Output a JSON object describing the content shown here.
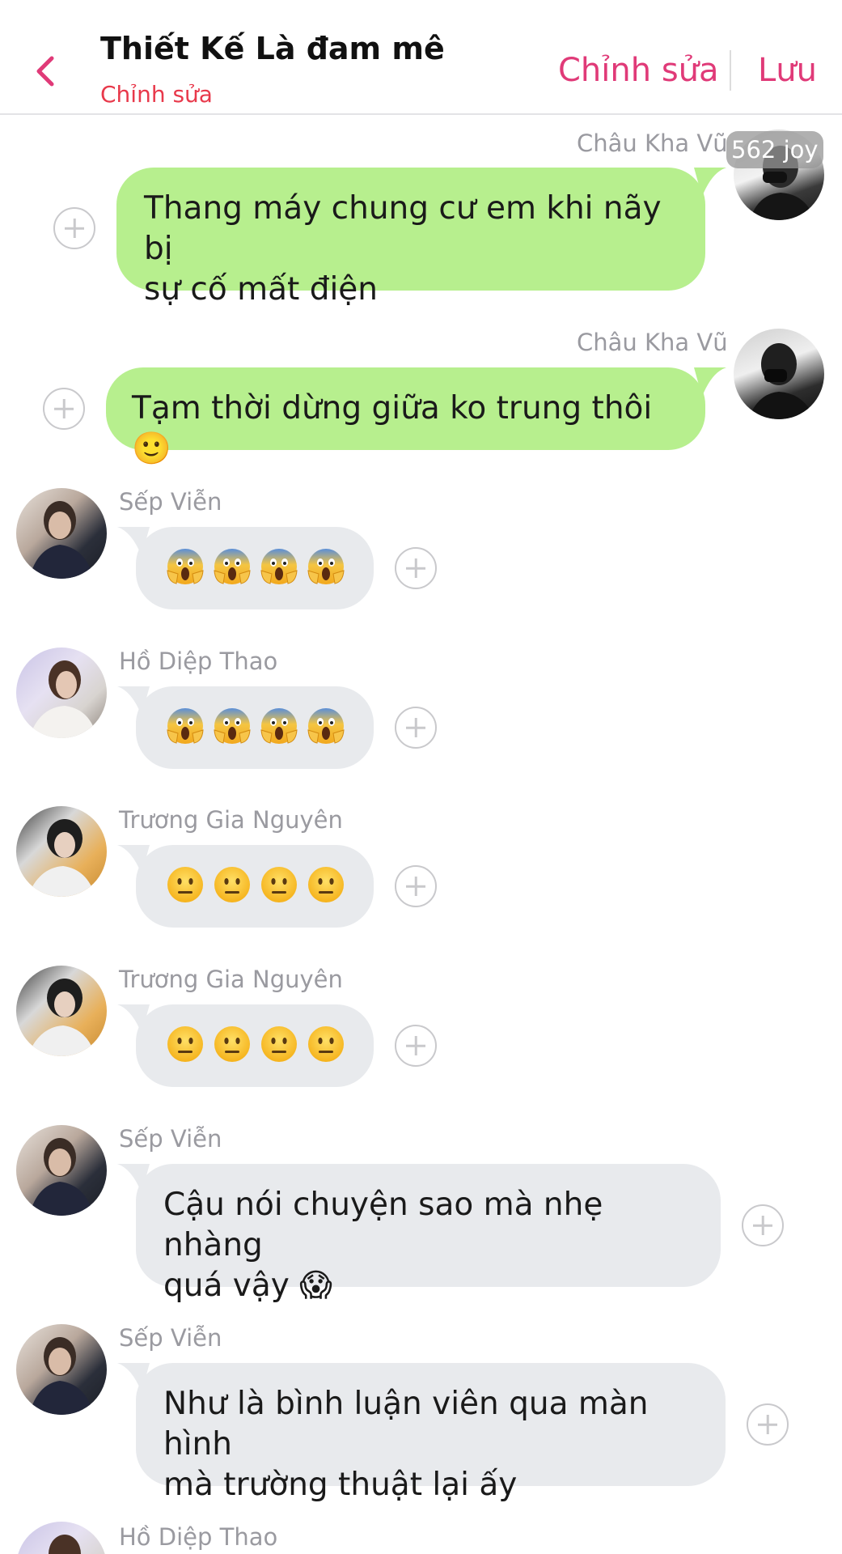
{
  "header": {
    "title": "Thiết Kế Là đam mê",
    "subtitle": "Chỉnh sửa",
    "edit_label": "Chỉnh sửa",
    "save_label": "Lưu",
    "accent_color": "#e03a78"
  },
  "joy_badge": "562 joy",
  "messages": [
    {
      "sender": "Châu Kha Vũ",
      "side": "right",
      "line1": "Thang máy chung cư em khi nãy bị",
      "line2": "sự cố mất điện"
    },
    {
      "sender": "Châu Kha Vũ",
      "side": "right",
      "line1": "Tạm thời dừng giữa ko trung thôi 🙂"
    },
    {
      "sender": "Sếp Viễn",
      "side": "left",
      "emoji": "scream",
      "count": 4
    },
    {
      "sender": "Hồ Diệp Thao",
      "side": "left",
      "emoji": "scream",
      "count": 4
    },
    {
      "sender": "Trương Gia Nguyên",
      "side": "left",
      "emoji": "neutral",
      "count": 4
    },
    {
      "sender": "Trương Gia Nguyên",
      "side": "left",
      "emoji": "neutral",
      "count": 4
    },
    {
      "sender": "Sếp Viễn",
      "side": "left",
      "line1": "Cậu nói chuyện sao mà nhẹ nhàng",
      "line2": "quá vậy 😱"
    },
    {
      "sender": "Sếp Viễn",
      "side": "left",
      "line1": "Như là bình luận viên qua màn hình",
      "line2": "mà trường thuật lại ấy"
    },
    {
      "sender": "Hồ Diệp Thao",
      "side": "left"
    }
  ],
  "colors": {
    "green_bubble": "#b7ef8e",
    "gray_bubble": "#e8eaed",
    "subtitle_red": "#e8394b"
  }
}
